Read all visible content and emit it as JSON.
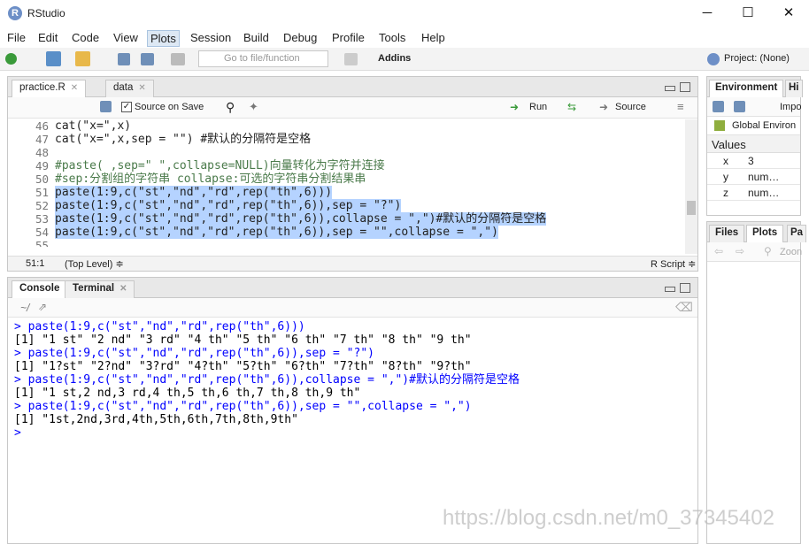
{
  "window": {
    "title": "RStudio",
    "minimize": "─",
    "maximize": "☐",
    "close": "✕"
  },
  "menu": [
    "File",
    "Edit",
    "Code",
    "View",
    "Plots",
    "Session",
    "Build",
    "Debug",
    "Profile",
    "Tools",
    "Help"
  ],
  "toolbar": {
    "goto_placeholder": "Go to file/function",
    "addins": "Addins",
    "project": "Project: (None)"
  },
  "editor": {
    "tabs": [
      {
        "label": "practice.R"
      },
      {
        "label": "data"
      }
    ],
    "source_on_save": "Source on Save",
    "run": "Run",
    "source": "Source",
    "lines": [
      {
        "n": "46",
        "t": "cat(\"x=\",x)",
        "sel": false,
        "cmt": false
      },
      {
        "n": "47",
        "t": "cat(\"x=\",x,sep = \"\") #默认的分隔符是空格",
        "sel": false,
        "cmt": false
      },
      {
        "n": "48",
        "t": "",
        "sel": false,
        "cmt": false
      },
      {
        "n": "49",
        "t": "#paste( ,sep=\" \",collapse=NULL)向量转化为字符并连接",
        "sel": false,
        "cmt": true
      },
      {
        "n": "50",
        "t": "#sep:分割组的字符串 collapse:可选的字符串分割结果串",
        "sel": false,
        "cmt": true
      },
      {
        "n": "51",
        "t": "paste(1:9,c(\"st\",\"nd\",\"rd\",rep(\"th\",6)))",
        "sel": true,
        "cmt": false
      },
      {
        "n": "52",
        "t": "paste(1:9,c(\"st\",\"nd\",\"rd\",rep(\"th\",6)),sep = \"?\")",
        "sel": true,
        "cmt": false
      },
      {
        "n": "53",
        "t": "paste(1:9,c(\"st\",\"nd\",\"rd\",rep(\"th\",6)),collapse = \",\")#默认的分隔符是空格",
        "sel": true,
        "cmt": false
      },
      {
        "n": "54",
        "t": "paste(1:9,c(\"st\",\"nd\",\"rd\",rep(\"th\",6)),sep = \"\",collapse = \",\")",
        "sel": true,
        "cmt": false
      },
      {
        "n": "55",
        "t": "",
        "sel": false,
        "cmt": false
      }
    ],
    "status_pos": "51:1",
    "status_scope": "(Top Level) ≑",
    "status_lang": "R Script ≑"
  },
  "console": {
    "tabs": [
      {
        "label": "Console"
      },
      {
        "label": "Terminal"
      }
    ],
    "path": "~/",
    "lines": [
      {
        "t": "> paste(1:9,c(\"st\",\"nd\",\"rd\",rep(\"th\",6)))",
        "cmd": true
      },
      {
        "t": "[1] \"1 st\" \"2 nd\" \"3 rd\" \"4 th\" \"5 th\" \"6 th\" \"7 th\" \"8 th\" \"9 th\"",
        "cmd": false
      },
      {
        "t": "> paste(1:9,c(\"st\",\"nd\",\"rd\",rep(\"th\",6)),sep = \"?\")",
        "cmd": true
      },
      {
        "t": "[1] \"1?st\" \"2?nd\" \"3?rd\" \"4?th\" \"5?th\" \"6?th\" \"7?th\" \"8?th\" \"9?th\"",
        "cmd": false
      },
      {
        "t": "> paste(1:9,c(\"st\",\"nd\",\"rd\",rep(\"th\",6)),collapse = \",\")#默认的分隔符是空格",
        "cmd": true
      },
      {
        "t": "[1] \"1 st,2 nd,3 rd,4 th,5 th,6 th,7 th,8 th,9 th\"",
        "cmd": false
      },
      {
        "t": "> paste(1:9,c(\"st\",\"nd\",\"rd\",rep(\"th\",6)),sep = \"\",collapse = \",\")",
        "cmd": true
      },
      {
        "t": "[1] \"1st,2nd,3rd,4th,5th,6th,7th,8th,9th\"",
        "cmd": false
      },
      {
        "t": ">",
        "cmd": true
      }
    ]
  },
  "env": {
    "tabs": [
      {
        "label": "Environment"
      },
      {
        "label": "Hi"
      }
    ],
    "import": "Impo",
    "global": "Global Environ",
    "values_header": "Values",
    "rows": [
      {
        "name": "x",
        "value": "3"
      },
      {
        "name": "y",
        "value": "num…"
      },
      {
        "name": "z",
        "value": "num…"
      }
    ]
  },
  "files": {
    "tabs": [
      {
        "label": "Files"
      },
      {
        "label": "Plots"
      },
      {
        "label": "Pa"
      }
    ],
    "zoom": "Zoon"
  },
  "watermark": "https://blog.csdn.net/m0_37345402",
  "colors": {
    "selection": "#b5d3ff",
    "comment": "#4a7a4a",
    "console_cmd": "#0000ff"
  }
}
